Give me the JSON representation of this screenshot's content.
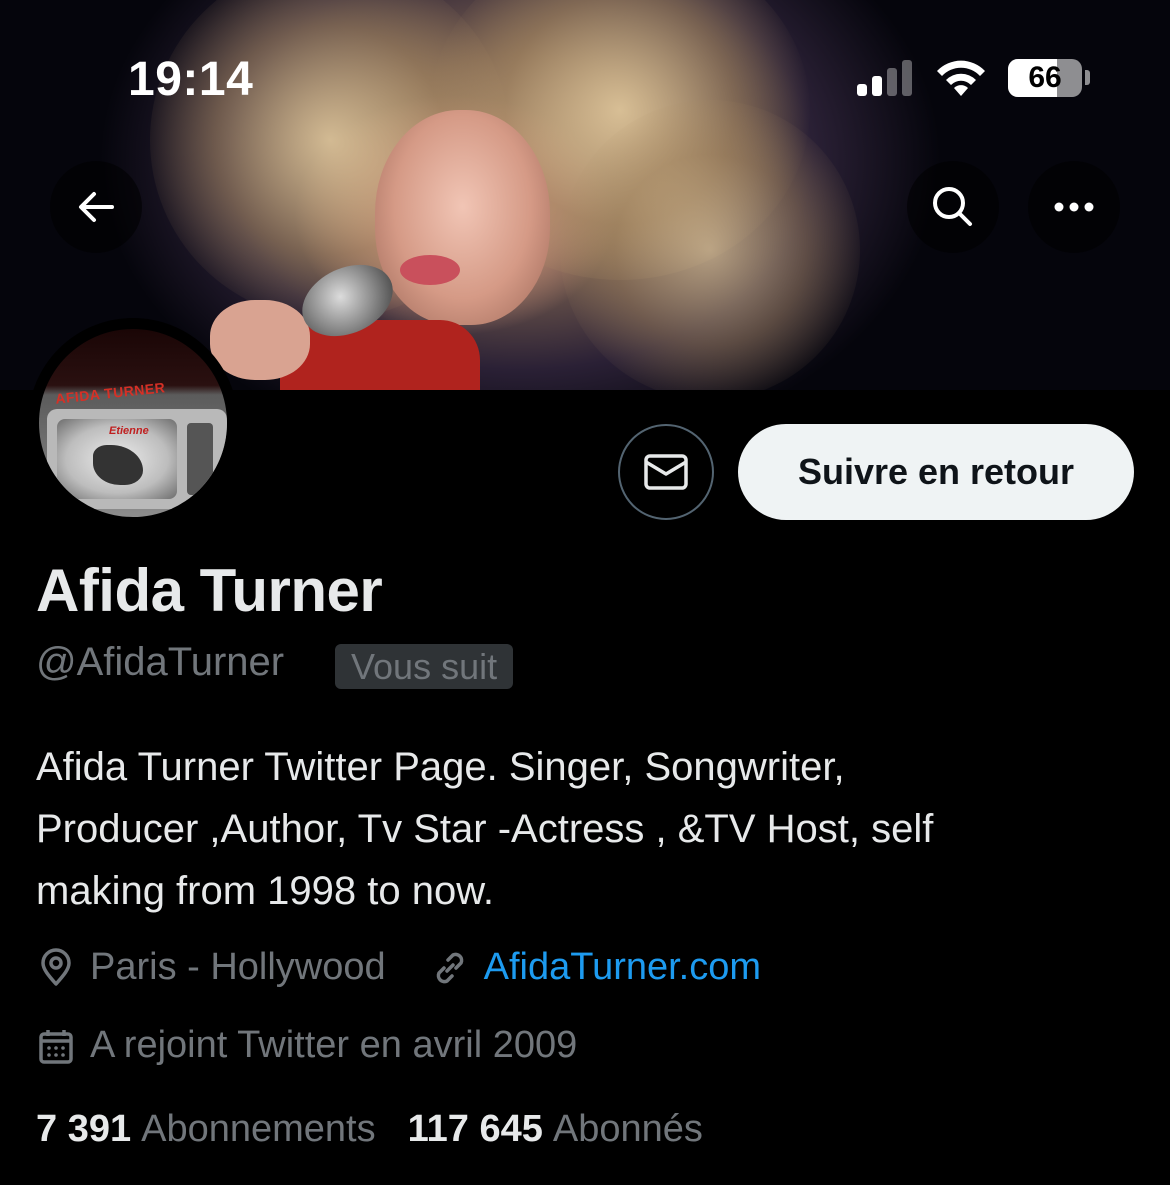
{
  "status_bar": {
    "time": "19:14",
    "battery_level": "66",
    "battery_fraction": 0.66,
    "signal_bars_active": 2,
    "signal_bars_total": 4
  },
  "nav": {
    "back_icon": "arrow-left-icon",
    "search_icon": "search-icon",
    "more_icon": "more-horizontal-icon"
  },
  "banner": {
    "description_icon": "header-photo"
  },
  "avatar": {
    "logo_text": "AFIDA TURNER",
    "screen_text": "Etienne"
  },
  "actions": {
    "message_icon": "mail-icon",
    "follow_back_label": "Suivre en retour"
  },
  "profile": {
    "name": "Afida Turner",
    "handle": "@AfidaTurner",
    "follows_you": "Vous suit",
    "bio": "Afida Turner Twitter Page. Singer, Songwriter,\nProducer ,Author, Tv Star -Actress , &TV Host, self\nmaking from 1998 to now.",
    "location": "Paris - Hollywood",
    "website": "AfidaTurner.com",
    "joined": "A rejoint Twitter en avril 2009",
    "following_count": "7 391",
    "following_label": "Abonnements",
    "followers_count": "117 645",
    "followers_label": "Abonnés"
  },
  "colors": {
    "background": "#000000",
    "primary_text": "#e7e9ea",
    "secondary_text": "#71767b",
    "link": "#1d9bf0",
    "follow_button_bg": "#eff3f4"
  }
}
